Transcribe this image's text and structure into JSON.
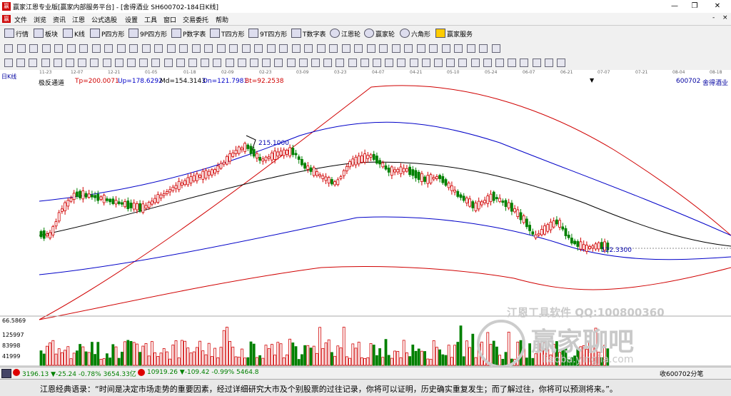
{
  "window": {
    "title": "赢家江恩专业版[赢家内部服务平台] - [舍得酒业  SH600702-184日K线]",
    "logo": "赢"
  },
  "menu": {
    "items": [
      "文件",
      "浏览",
      "资讯",
      "江恩",
      "公式选股",
      "设置",
      "工具",
      "窗口",
      "交易委托",
      "帮助"
    ],
    "right": [
      "-",
      "×"
    ]
  },
  "toolbar1": {
    "items": [
      "行情",
      "板块",
      "K线",
      "P四方形",
      "9P四方形",
      "P数字表",
      "T四方形",
      "9T四方形",
      "T数字表",
      "江恩轮",
      "赢家轮",
      "六角形",
      "赢家服务"
    ]
  },
  "axis": {
    "label": "日K线",
    "ticks": [
      "11-23",
      "12-07",
      "12-21",
      "01-05",
      "01-18",
      "02-09",
      "02-23",
      "03-09",
      "03-23",
      "04-07",
      "04-21",
      "05-10",
      "05-24",
      "06-07",
      "06-21",
      "07-07",
      "07-21",
      "08-04",
      "08-18"
    ]
  },
  "indicator": {
    "name": "极反通道",
    "tp": "Tp=200.0071",
    "up": "Up=178.6292",
    "md": "Md=154.3143",
    "dn": "Dn=121.7981",
    "bt": "Bt=92.2538",
    "code": "600702",
    "stock": "舍得酒业"
  },
  "chart_data": {
    "type": "candlestick",
    "annotations": [
      "215.1000",
      "122.3300"
    ],
    "volume_axis": [
      "66.5869",
      "125997",
      "83998",
      "41999"
    ],
    "colors": {
      "up": "#d00000",
      "down": "#008000",
      "top": "#d00000",
      "upper": "#0000c8",
      "mid": "#000000"
    }
  },
  "statusbar": {
    "sh": "3196.13 ▼-25.24 -0.78% 3654.33亿",
    "sz": "10919.26 ▼-109.42 -0.99% 5464.8",
    "right": "收600702分笔"
  },
  "watermark": {
    "line1": "江恩工具软件  QQ:100800360",
    "line2": "赢家聊吧",
    "line3": "liaoba.yingjia.com"
  },
  "quote": {
    "text": "江恩经典语录：“时间是决定市场走势的重要因素，经过详细研究大市及个别股票的过往记录，你将可以证明，历史确实重复发生；而了解过往，你将可以预测将来。”。"
  }
}
